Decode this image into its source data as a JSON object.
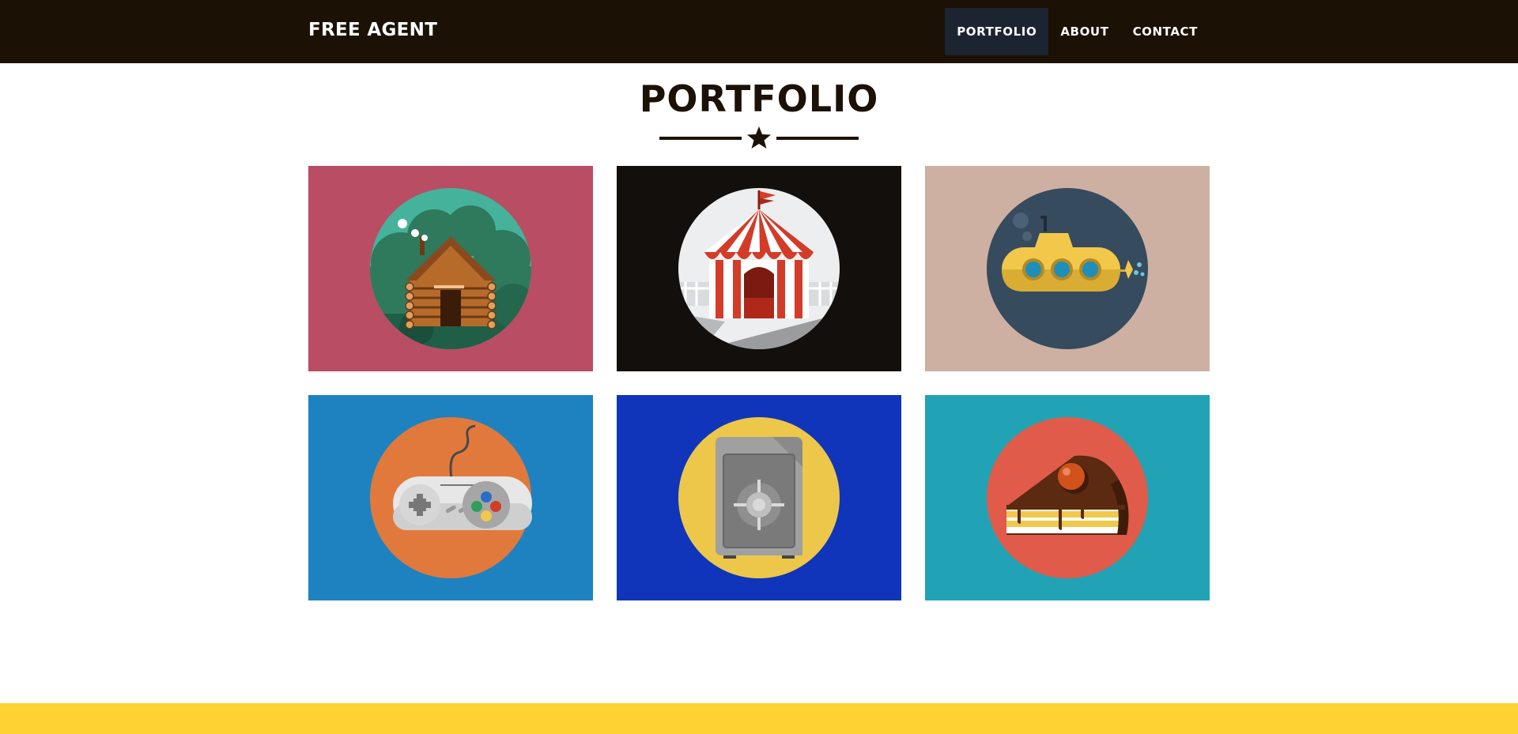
{
  "navbar": {
    "brand": "FREE AGENT",
    "links": [
      {
        "label": "PORTFOLIO",
        "active": true
      },
      {
        "label": "ABOUT",
        "active": false
      },
      {
        "label": "CONTACT",
        "active": false
      }
    ]
  },
  "portfolio": {
    "title": "PORTFOLIO",
    "divider_icon": "star-icon",
    "items": [
      {
        "icon": "cabin-icon",
        "tile_color": "#b94d63",
        "circle_color": "#45b39c"
      },
      {
        "icon": "circus-tent-icon",
        "tile_color": "#130f0d",
        "circle_color": "#eceeef"
      },
      {
        "icon": "submarine-icon",
        "tile_color": "#cdb0a2",
        "circle_color": "#364b5e"
      },
      {
        "icon": "game-controller-icon",
        "tile_color": "#1e82c0",
        "circle_color": "#e2793c"
      },
      {
        "icon": "safe-icon",
        "tile_color": "#1035ba",
        "circle_color": "#ecc74a"
      },
      {
        "icon": "cake-slice-icon",
        "tile_color": "#21a3b5",
        "circle_color": "#e05b4a"
      }
    ]
  },
  "colors": {
    "navbar_bg": "#1b1105",
    "active_link_bg": "#1c2331",
    "title_color": "#1b1105",
    "footer_band": "#fdd232"
  }
}
